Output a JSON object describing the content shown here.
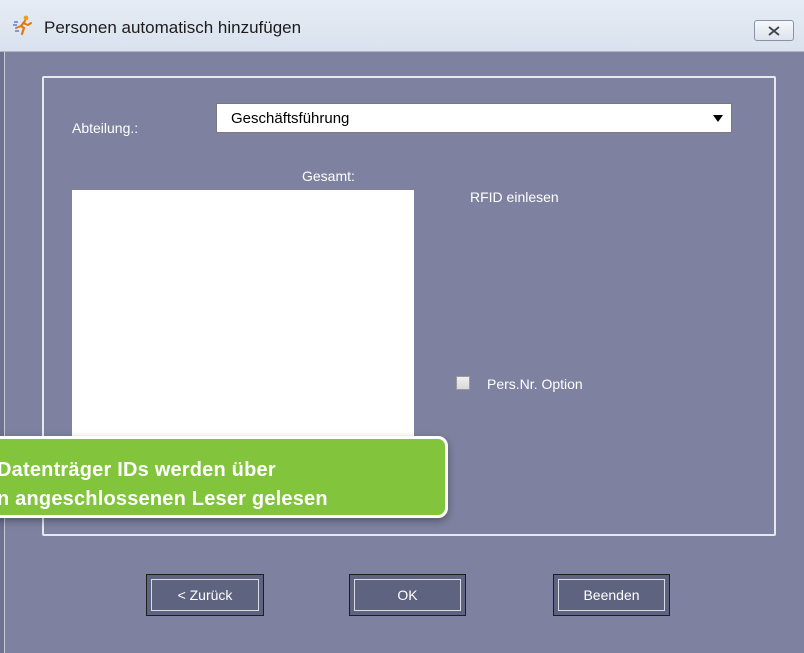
{
  "window": {
    "title": "Personen automatisch hinzufügen",
    "icon": "running-person-icon",
    "close_icon": "close-icon"
  },
  "form": {
    "department_label": "Abteilung.:",
    "department_value": "Geschäftsführung",
    "total_label": "Gesamt:",
    "rfid_label": "RFID einlesen",
    "pers_nr_option_label": "Pers.Nr. Option",
    "pers_nr_option_checked": false
  },
  "tooltip": {
    "line1": "Datenträger IDs werden über",
    "line2": "n angeschlossenen Leser gelesen",
    "color": "#82c43c"
  },
  "buttons": {
    "back": "< Zurück",
    "ok": "OK",
    "quit": "Beenden"
  },
  "colors": {
    "background": "#7e82a0",
    "button": "#5e6380"
  }
}
